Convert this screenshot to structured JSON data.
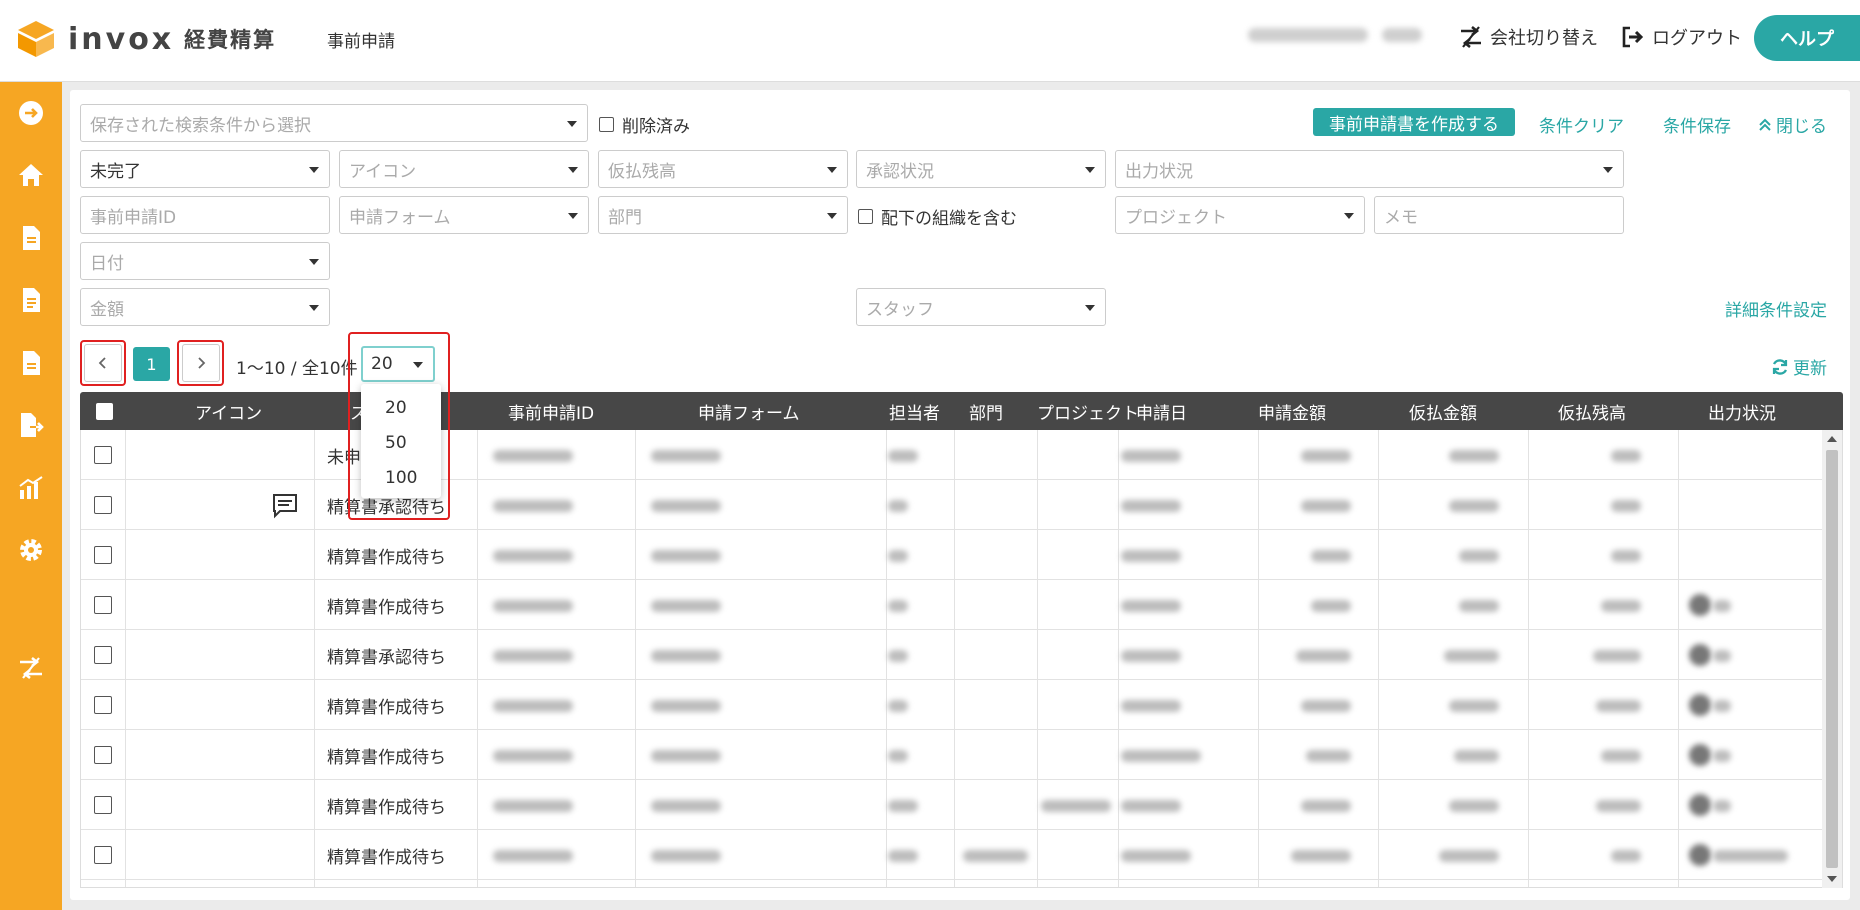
{
  "header": {
    "logo_text": "invox",
    "logo_sub": "経費精算",
    "nav_title": "事前申請",
    "switch_company": "会社切り替え",
    "logout": "ログアウト",
    "help": "ヘルプ"
  },
  "sidebar": {
    "icons": [
      "arrow-right-circle-icon",
      "home-icon",
      "document-icon",
      "document-list-icon",
      "document-text-icon",
      "document-export-icon",
      "bar-chart-icon",
      "gear-icon",
      "switch-icon"
    ]
  },
  "filters": {
    "saved_search_placeholder": "保存された検索条件から選択",
    "deleted_label": "削除済み",
    "create_button": "事前申請書を作成する",
    "clear_link": "条件クリア",
    "save_link": "条件保存",
    "close_link": "閉じる",
    "status_value": "未完了",
    "icon_placeholder": "アイコン",
    "advance_balance_placeholder": "仮払残高",
    "approval_placeholder": "承認状況",
    "output_placeholder": "出力状況",
    "request_id_placeholder": "事前申請ID",
    "form_placeholder": "申請フォーム",
    "department_placeholder": "部門",
    "include_sub_label": "配下の組織を含む",
    "project_placeholder": "プロジェクト",
    "memo_placeholder": "メモ",
    "date_placeholder": "日付",
    "amount_placeholder": "金額",
    "staff_placeholder": "スタッフ",
    "detail_link": "詳細条件設定"
  },
  "pagination": {
    "current_page": "1",
    "info": "1〜10 / 全10件",
    "per_page": "20",
    "options": [
      "20",
      "50",
      "100"
    ],
    "refresh": "更新"
  },
  "table": {
    "headers": [
      "アイコン",
      "ス",
      "事前申請ID",
      "申請フォーム",
      "担当者",
      "部門",
      "プロジェクト",
      "申請日",
      "申請金額",
      "仮払金額",
      "仮払残高",
      "出力状況"
    ],
    "rows": [
      {
        "status": "未申"
      },
      {
        "status": "精算書承認待ち"
      },
      {
        "status": "精算書作成待ち"
      },
      {
        "status": "精算書作成待ち"
      },
      {
        "status": "精算書承認待ち"
      },
      {
        "status": "精算書作成待ち"
      },
      {
        "status": "精算書作成待ち"
      },
      {
        "status": "精算書作成待ち"
      },
      {
        "status": "精算書作成待ち"
      }
    ]
  },
  "colors": {
    "accent": "#2aa7a5",
    "sidebar": "#f6a623",
    "table_header": "#474747",
    "highlight": "#e02020"
  }
}
